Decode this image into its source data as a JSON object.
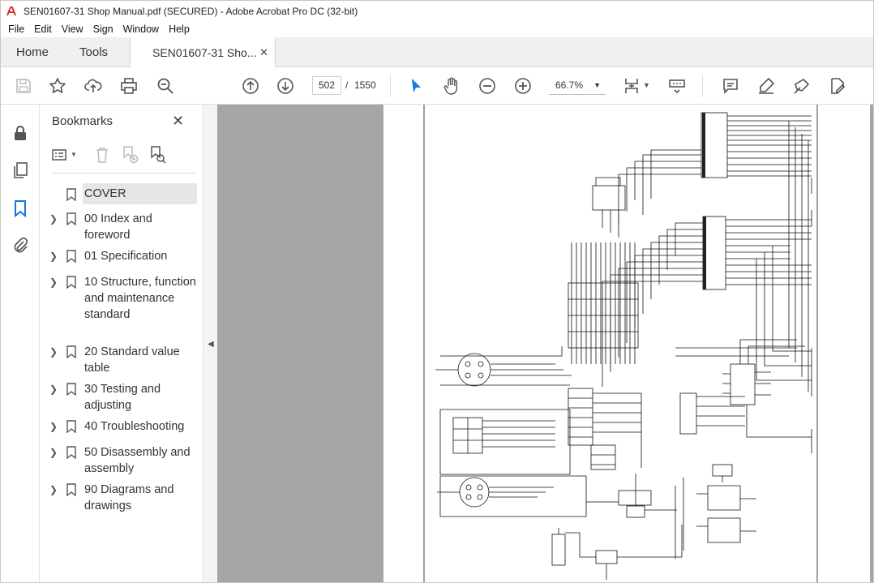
{
  "window": {
    "title": "SEN01607-31 Shop Manual.pdf (SECURED) - Adobe Acrobat Pro DC (32-bit)"
  },
  "menu": [
    "File",
    "Edit",
    "View",
    "Sign",
    "Window",
    "Help"
  ],
  "tabs": {
    "home": "Home",
    "tools": "Tools",
    "document": "SEN01607-31 Sho...",
    "close": "✕"
  },
  "toolbar": {
    "current_page": "502",
    "separator": "/",
    "total_pages": "1550",
    "zoom": "66.7%"
  },
  "bookmarks": {
    "title": "Bookmarks",
    "close": "✕",
    "items": [
      {
        "label": "COVER",
        "expandable": false,
        "selected": true
      },
      {
        "label": "00 Index and foreword",
        "expandable": true
      },
      {
        "label": "01 Specification",
        "expandable": true
      },
      {
        "label": "10 Structure, function and maintenance standard",
        "expandable": true
      },
      {
        "label": "20 Standard value table",
        "expandable": true
      },
      {
        "label": "30 Testing and adjusting",
        "expandable": true
      },
      {
        "label": "40 Troubleshooting",
        "expandable": true
      },
      {
        "label": "50 Disassembly and assembly",
        "expandable": true
      },
      {
        "label": "90 Diagrams and drawings",
        "expandable": true
      }
    ]
  },
  "icons": {
    "rail": [
      "lock-icon",
      "pages-icon",
      "bookmark-icon",
      "paperclip-icon"
    ],
    "toolbar": [
      "save-icon",
      "star-icon",
      "upload-icon",
      "print-icon",
      "zoom-search-icon",
      "page-up-icon",
      "page-down-icon",
      "select-cursor-icon",
      "hand-icon",
      "zoom-out-icon",
      "zoom-in-icon",
      "fit-page-icon",
      "scroll-mode-icon",
      "comment-icon",
      "highlight-icon",
      "sign-icon",
      "edit-pdf-icon"
    ]
  },
  "colors": {
    "accent": "#1473e6",
    "doc_background": "#a6a6a6",
    "logo_red": "#d32020"
  }
}
